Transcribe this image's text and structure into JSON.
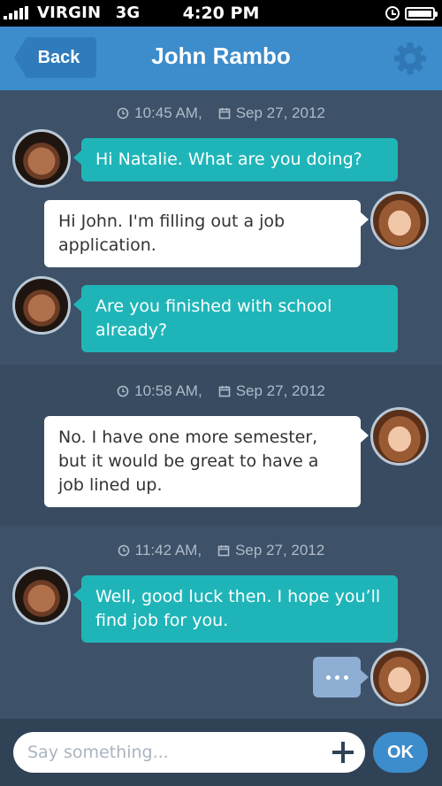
{
  "status_bar": {
    "carrier": "VIRGIN",
    "network": "3G",
    "time": "4:20 PM"
  },
  "nav": {
    "back_label": "Back",
    "title": "John Rambo"
  },
  "groups": [
    {
      "time": "10:45 AM,",
      "date": "Sep 27, 2012",
      "messages": [
        {
          "sender": "John Rambo",
          "text": "Hi Natalie. What are you doing?"
        },
        {
          "sender": "Natalie",
          "text": "Hi John. I'm filling out a job application."
        },
        {
          "sender": "John Rambo",
          "text": "Are you finished with school already?"
        }
      ]
    },
    {
      "time": "10:58 AM,",
      "date": "Sep 27, 2012",
      "messages": [
        {
          "sender": "Natalie",
          "text": "No. I have one more semester, but it would be great to have a job lined up."
        }
      ]
    },
    {
      "time": "11:42 AM,",
      "date": "Sep 27, 2012",
      "messages": [
        {
          "sender": "John Rambo",
          "text": "Well, good luck then. I hope you’ll find job for you."
        }
      ]
    }
  ],
  "input": {
    "placeholder": "Say something...",
    "value": "",
    "submit_label": "OK"
  },
  "colors": {
    "nav": "#3d8ccb",
    "background": "#3d5168",
    "incoming_bubble": "#1fb5b8",
    "outgoing_bubble": "#ffffff",
    "typing_bubble": "#8eaed3"
  },
  "icons": [
    "signal-icon",
    "lock-rotation-icon",
    "battery-icon",
    "gear-icon",
    "clock-icon",
    "calendar-icon",
    "plus-icon",
    "typing-dots-icon"
  ]
}
